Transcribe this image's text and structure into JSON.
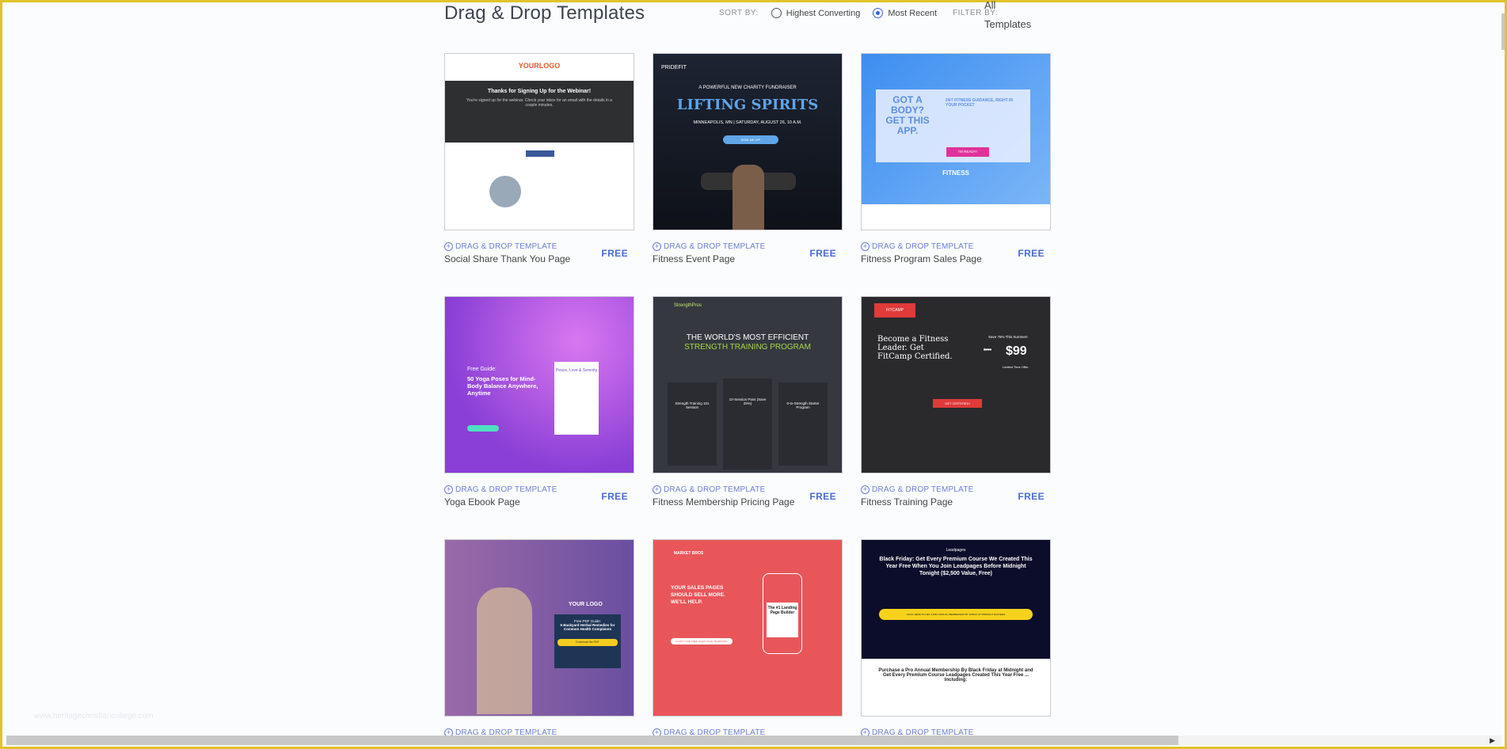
{
  "header": {
    "title": "Drag & Drop Templates",
    "sort_label": "SORT BY:",
    "sort_options": [
      {
        "label": "Highest Converting",
        "selected": false
      },
      {
        "label": "Most Recent",
        "selected": true
      }
    ],
    "filter_label": "FILTER BY:",
    "filter_value": "All Templates"
  },
  "accent": "#4a6bd6",
  "card_tag": "DRAG & DROP TEMPLATE",
  "cards": [
    {
      "name": "Social Share Thank You Page",
      "price": "FREE",
      "thumb": {
        "logo": "YOURLOGO",
        "headline": "Thanks for Signing Up for the Webinar!",
        "body": "You're signed up for the webinar. Check your inbox for an email with the details in a couple minutes."
      }
    },
    {
      "name": "Fitness Event Page",
      "price": "FREE",
      "thumb": {
        "logo": "PRIDEFIT",
        "kicker": "A POWERFUL NEW CHARITY FUNDRAISER",
        "headline": "LIFTING SPIRITS",
        "sub": "MINNEAPOLIS, MN | SATURDAY, AUGUST 26, 10 A.M.",
        "cta": "SIGN ME UP!"
      }
    },
    {
      "name": "Fitness Program Sales Page",
      "price": "FREE",
      "thumb": {
        "headline": "GOT A BODY? GET THIS APP.",
        "sub": "24/7 FITNESS GUIDANCE, RIGHT IN YOUR POCKET",
        "cta": "I'M READY!",
        "logo": "FITNESS"
      }
    },
    {
      "name": "Yoga Ebook Page",
      "price": "FREE",
      "thumb": {
        "kicker": "Free Guide:",
        "headline": "50 Yoga Poses for Mind-Body Balance Anywhere, Anytime",
        "book": "Peace, Love & Serenity"
      }
    },
    {
      "name": "Fitness Membership Pricing Page",
      "price": "FREE",
      "thumb": {
        "logo": "StrengthPros",
        "headline": "THE WORLD'S MOST EFFICIENT",
        "headline2": "STRENGTH TRAINING PROGRAM",
        "plans": [
          "Strength Training 101 Session",
          "10-Session Pass (Save 25%)",
          "0-to-Strength Starter Program"
        ]
      }
    },
    {
      "name": "Fitness Training Page",
      "price": "FREE",
      "thumb": {
        "logo": "FITCAMP",
        "headline": "Become a Fitness Leader. Get FitCamp Certified.",
        "offer": "Save 75% This Summer!",
        "old_price": "$999",
        "price": "$99",
        "note": "Limited Time Offer",
        "cta": "GET CERTIFIED!"
      }
    },
    {
      "name": "",
      "price": "",
      "thumb": {
        "logo": "YOUR LOGO",
        "kicker": "Free PDF Guide:",
        "headline": "5 Backyard Herbal Remedies for Common Health Complaints",
        "cta": "Download the PDF"
      }
    },
    {
      "name": "",
      "price": "",
      "thumb": {
        "logo": "MARKET BROS",
        "headline": "YOUR SALES PAGES SHOULD SELL MORE. WE'LL HELP.",
        "cta": "CLAIM YOUR FREE SALES PAGE TEARDOWN",
        "phone": "The #1 Landing Page Builder"
      }
    },
    {
      "name": "",
      "price": "",
      "thumb": {
        "logo": "Leadpages",
        "headline": "Black Friday: Get Every Premium Course We Created This Year Free When You Join Leadpages Before Midnight Tonight ($2,500 Value, Free)",
        "cta": "CLICK HERE TO GET A PRO ANNUAL MEMBERSHIP BY FRIDAY AT MIDNIGHT EASTERN",
        "sub": "Purchase a Pro Annual Membership By Black Friday at Midnight and Get Every Premium Course Leadpages Created This Year Free ... Including:"
      }
    }
  ],
  "watermark": "www.heritagechristiancollege.com"
}
